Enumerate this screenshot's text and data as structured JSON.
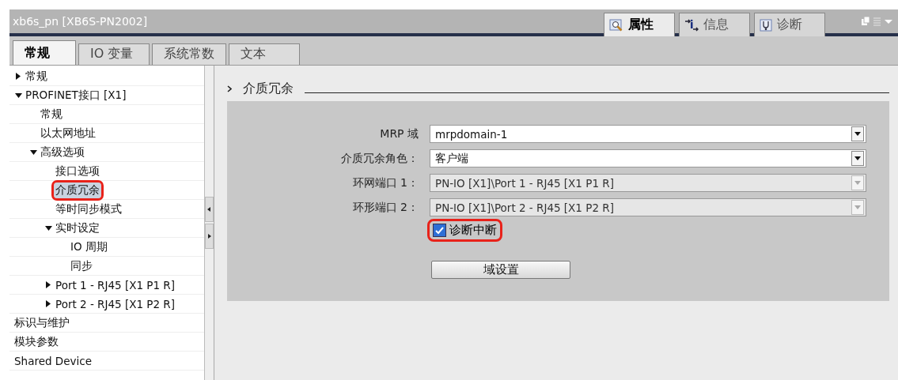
{
  "window": {
    "title": "xb6s_pn [XB6S-PN2002]"
  },
  "inspector_tabs": [
    {
      "label": "属性",
      "selected": true
    },
    {
      "label": "信息",
      "selected": false
    },
    {
      "label": "诊断",
      "selected": false
    }
  ],
  "tabs": [
    {
      "label": "常规",
      "selected": true
    },
    {
      "label": "IO 变量",
      "selected": false
    },
    {
      "label": "系统常数",
      "selected": false
    },
    {
      "label": "文本",
      "selected": false
    }
  ],
  "sidebar": {
    "items": [
      {
        "label": "常规",
        "expanded": false
      },
      {
        "label": "PROFINET接口 [X1]",
        "expanded": true,
        "children": [
          {
            "label": "常规"
          },
          {
            "label": "以太网地址"
          },
          {
            "label": "高级选项",
            "expanded": true,
            "children": [
              {
                "label": "接口选项"
              },
              {
                "label": "介质冗余",
                "selected": true,
                "highlighted": true
              },
              {
                "label": "等时同步模式"
              },
              {
                "label": "实时设定",
                "expanded": true,
                "children": [
                  {
                    "label": "IO 周期"
                  },
                  {
                    "label": "同步"
                  }
                ]
              },
              {
                "label": "Port 1 - RJ45 [X1 P1 R]",
                "expanded": false
              },
              {
                "label": "Port 2 - RJ45 [X1 P2 R]",
                "expanded": false
              }
            ]
          }
        ]
      },
      {
        "label": "标识与维护"
      },
      {
        "label": "模块参数"
      },
      {
        "label": "Shared Device"
      }
    ]
  },
  "section": {
    "title": "介质冗余",
    "fields": [
      {
        "label": "MRP 域",
        "value": "mrpdomain-1",
        "disabled": false
      },
      {
        "label": "介质冗余角色：",
        "value": "客户端",
        "disabled": false
      },
      {
        "label": "环网端口 1：",
        "value": "PN-IO [X1]\\Port 1 - RJ45 [X1 P1 R]",
        "disabled": true
      },
      {
        "label": "环形端口 2：",
        "value": "PN-IO [X1]\\Port 2 - RJ45 [X1 P2 R]",
        "disabled": true
      }
    ],
    "checkbox": {
      "label": "诊断中断",
      "checked": true,
      "highlighted": true
    },
    "button": "域设置"
  }
}
